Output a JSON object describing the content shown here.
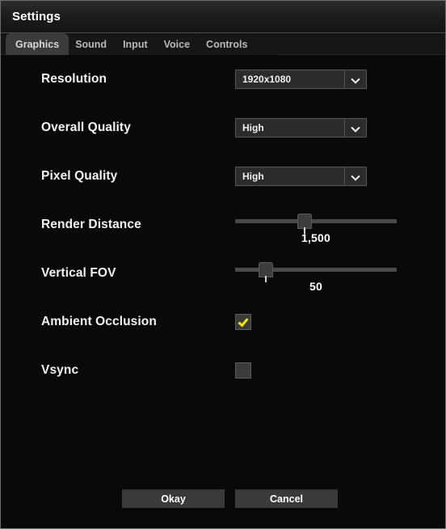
{
  "window": {
    "title": "Settings",
    "border_color": "#6d6d6d",
    "background": "#090909"
  },
  "tabs": {
    "active_index": 0,
    "items": [
      {
        "label": "Graphics"
      },
      {
        "label": "Sound"
      },
      {
        "label": "Input"
      },
      {
        "label": "Voice"
      },
      {
        "label": "Controls"
      }
    ]
  },
  "settings": {
    "resolution": {
      "label": "Resolution",
      "type": "dropdown",
      "value": "1920x1080",
      "arrow_icon": "chevron-down-icon"
    },
    "overall_quality": {
      "label": "Overall Quality",
      "type": "dropdown",
      "value": "High",
      "arrow_icon": "chevron-down-icon"
    },
    "pixel_quality": {
      "label": "Pixel Quality",
      "type": "dropdown",
      "value": "High",
      "arrow_icon": "chevron-down-icon"
    },
    "render_distance": {
      "label": "Render Distance",
      "type": "slider",
      "value": "1,500",
      "handle_percent": 43
    },
    "vertical_fov": {
      "label": "Vertical FOV",
      "type": "slider",
      "value": "50",
      "handle_percent": 19
    },
    "ambient_occlusion": {
      "label": "Ambient Occlusion",
      "type": "checkbox",
      "checked": true,
      "check_color": "#f2e317"
    },
    "vsync": {
      "label": "Vsync",
      "type": "checkbox",
      "checked": false
    }
  },
  "footer": {
    "okay_label": "Okay",
    "cancel_label": "Cancel"
  }
}
